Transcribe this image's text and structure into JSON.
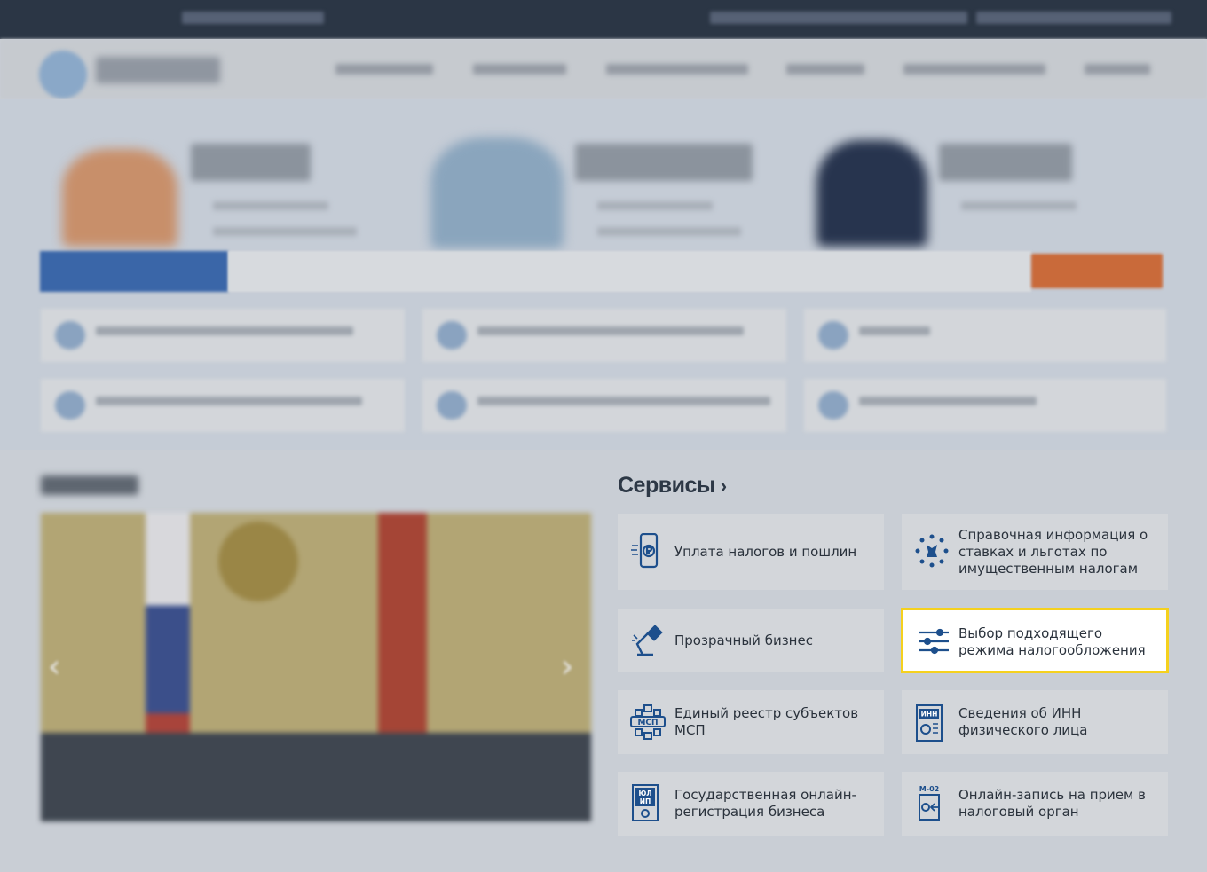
{
  "page": {
    "dimmed": true,
    "highlight_color": "#f5d11e",
    "accent": "#1d4f8c"
  },
  "services": {
    "title": "Сервисы",
    "items": [
      {
        "label": "Уплата налогов и пошлин",
        "icon": "phone-ruble-icon"
      },
      {
        "label": "Справочная информация о ставках и льготах по имущественным налогам",
        "icon": "emblem-circle-icon"
      },
      {
        "label": "Прозрачный бизнес",
        "icon": "desk-lamp-icon"
      },
      {
        "label": "Выбор подходящего режима налогообложения",
        "icon": "sliders-icon",
        "highlighted": true
      },
      {
        "label": "Единый реестр субъектов МСП",
        "icon": "msp-network-icon"
      },
      {
        "label": "Сведения об ИНН физического лица",
        "icon": "inn-document-icon"
      },
      {
        "label": "Государственная онлайн-регистрация бизнеса",
        "icon": "ul-ip-document-icon"
      },
      {
        "label": "Онлайн-запись на прием в налоговый орган",
        "icon": "m02-document-icon"
      }
    ]
  }
}
